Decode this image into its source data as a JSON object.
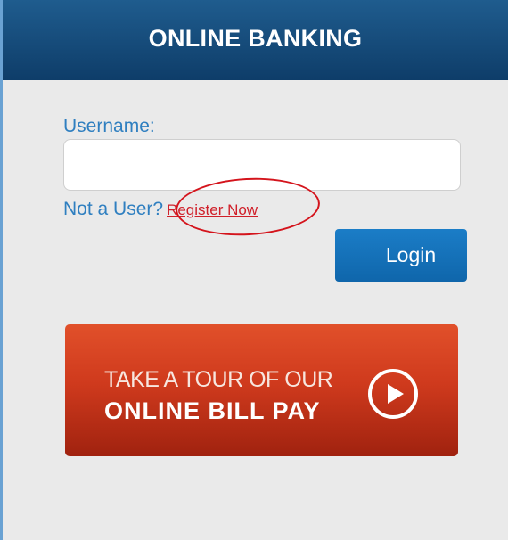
{
  "header": {
    "title": "ONLINE BANKING"
  },
  "form": {
    "username_label": "Username:",
    "username_value": "",
    "not_user_text": "Not a User?",
    "register_link": "Register Now",
    "login_button": "Login"
  },
  "tour_banner": {
    "line1": "TAKE A TOUR OF OUR",
    "line2": "ONLINE BILL PAY",
    "icon": "play-circle-icon"
  },
  "colors": {
    "header": "#0e3d69",
    "link": "#2f7fc0",
    "register": "#d0202a",
    "login": "#1b7dc7",
    "banner": "#cf3a1d"
  }
}
